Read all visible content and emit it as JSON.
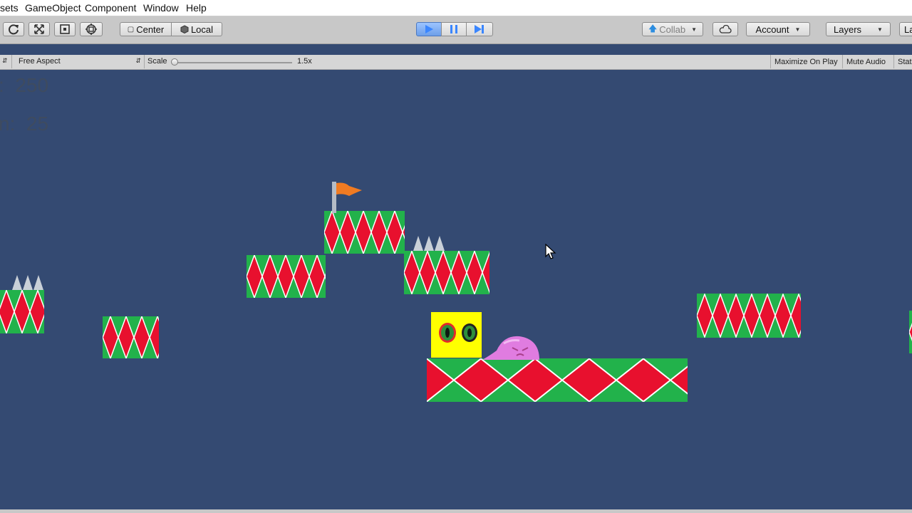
{
  "menu": [
    "sets",
    "GameObject",
    "Component",
    "Window",
    "Help"
  ],
  "toolbar": {
    "center_label": "Center",
    "local_label": "Local",
    "collab_label": "Collab",
    "account_label": "Account",
    "layers_label": "Layers",
    "layout_label_partial": "La",
    "play_state": "playing"
  },
  "game_view": {
    "aspect_label": "Free Aspect",
    "scale_label": "Scale",
    "scale_value": "1.5x",
    "scale_slider_position": 0.0,
    "maximize_on_play": "Maximize On Play",
    "mute_audio": "Mute Audio",
    "stats_partial": "Stat"
  },
  "hud": {
    "line1_prefix": ":",
    "line1_value": "250",
    "line2_prefix": "n:",
    "line2_value": "25"
  },
  "colors": {
    "background": "#344a72",
    "tile_green": "#22b24b",
    "tile_red": "#e8102e",
    "player_yellow": "#ffff00",
    "enemy_pink": "#e07ce0",
    "flag_orange": "#f07b22",
    "play_blue": "#3a86ff"
  },
  "icons": [
    "refresh-icon",
    "move-icon",
    "rect-tool-icon",
    "transform-icon",
    "cube-icon",
    "cloud-icon",
    "play-icon",
    "pause-icon",
    "step-icon",
    "flag-icon",
    "cursor-icon"
  ]
}
